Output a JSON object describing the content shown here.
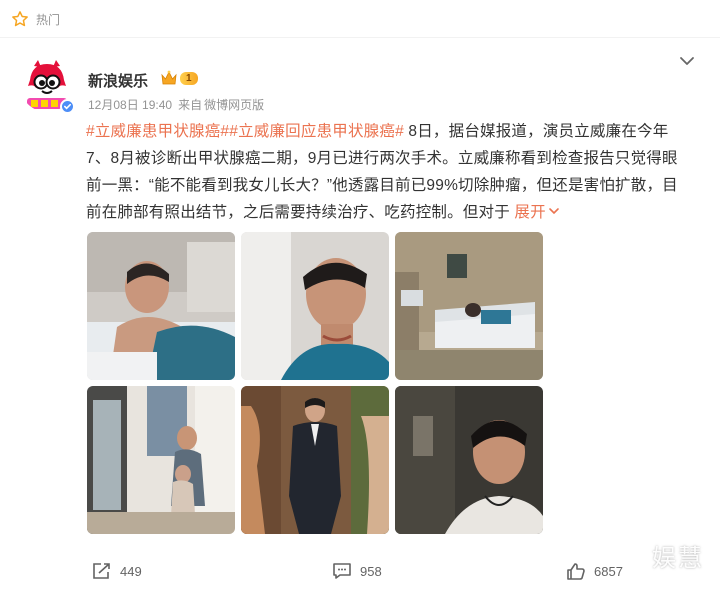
{
  "header": {
    "hot_label": "热门",
    "icons": {
      "hot": "star-outline-icon",
      "collapse": "chevron-down-icon"
    }
  },
  "post": {
    "author": {
      "name": "新浪娱乐",
      "verified": true,
      "vip_level": "1",
      "avatar": "sina-ent-logo"
    },
    "meta": {
      "date": "12月08日 19:40",
      "source_prefix": "来自",
      "source": "微博网页版"
    },
    "text": {
      "tag1": "#立威廉患甲状腺癌#",
      "tag2": "#立威廉回应患甲状腺癌#",
      "body": " 8日，据台媒报道，演员立威廉在今年7、8月被诊断出甲状腺癌二期，9月已进行两次手术。立威廉称看到检查报告只觉得眼前一黑：“能不能看到我女儿长大？”他透露目前已99%切除肿瘤，但还是害怕扩散，目前在肺部有照出结节，之后需要持续治疗、吃药控制。但对于 ",
      "expand_label": "展开"
    },
    "photos": [
      {
        "desc": "hospital-bed-photo"
      },
      {
        "desc": "neck-scar-selfie-photo"
      },
      {
        "desc": "hospital-room-photo"
      },
      {
        "desc": "father-daughter-photo"
      },
      {
        "desc": "suit-portrait-photo"
      },
      {
        "desc": "drama-still-photo"
      }
    ],
    "actions": {
      "repost_count": "449",
      "comment_count": "958",
      "like_count": "6857"
    }
  },
  "watermark": "娱慧",
  "colors": {
    "tag": "#eb7350",
    "meta_gray": "#939393",
    "vip_gold": "#f6a623",
    "verified_blue": "#4d8ef7"
  }
}
